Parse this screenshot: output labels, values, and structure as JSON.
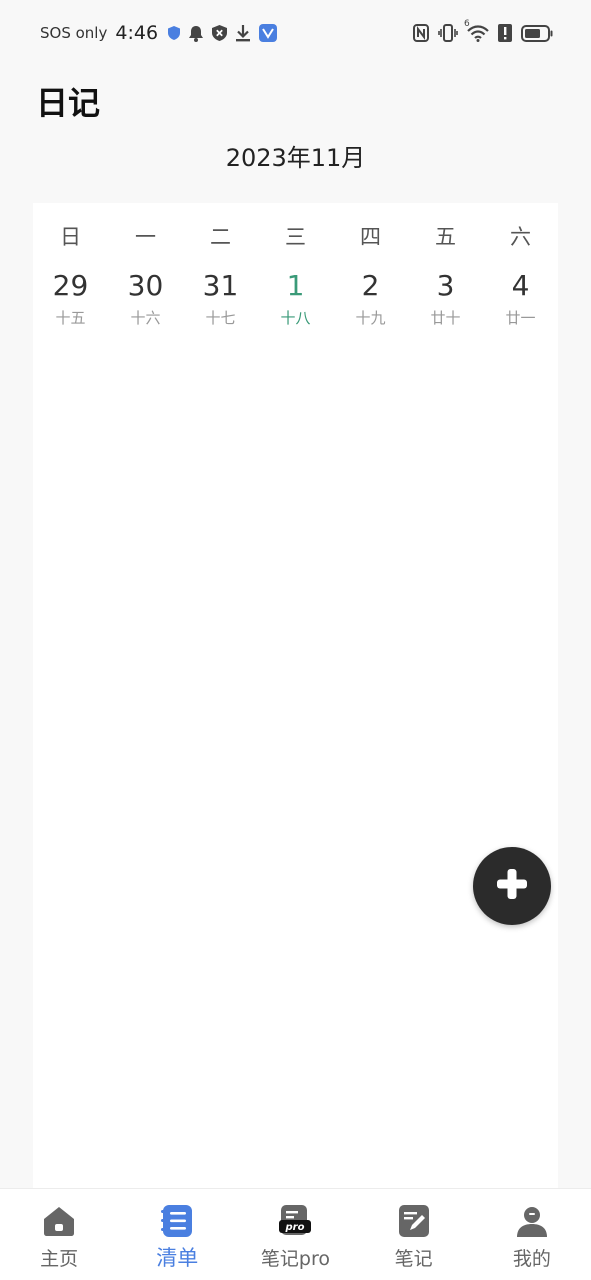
{
  "status_bar": {
    "carrier": "SOS only",
    "time": "4:46",
    "wifi_superscript": "6"
  },
  "header": {
    "title": "日记",
    "month": "2023年11月"
  },
  "calendar": {
    "weekdays": [
      "日",
      "一",
      "二",
      "三",
      "四",
      "五",
      "六"
    ],
    "dates": [
      {
        "day": "29",
        "lunar": "十五"
      },
      {
        "day": "30",
        "lunar": "十六"
      },
      {
        "day": "31",
        "lunar": "十七"
      },
      {
        "day": "1",
        "lunar": "十八",
        "today": true
      },
      {
        "day": "2",
        "lunar": "十九"
      },
      {
        "day": "3",
        "lunar": "廿十"
      },
      {
        "day": "4",
        "lunar": "廿一"
      }
    ],
    "today_color": "#3a9a78"
  },
  "fab": {
    "icon": "plus-icon"
  },
  "bottom_nav": {
    "items": [
      {
        "label": "主页",
        "icon": "home-icon"
      },
      {
        "label": "清单",
        "icon": "list-icon",
        "active": true
      },
      {
        "label": "笔记pro",
        "icon": "note-pro-icon"
      },
      {
        "label": "笔记",
        "icon": "note-edit-icon"
      },
      {
        "label": "我的",
        "icon": "profile-icon"
      }
    ],
    "active_color": "#4a7fe0"
  }
}
